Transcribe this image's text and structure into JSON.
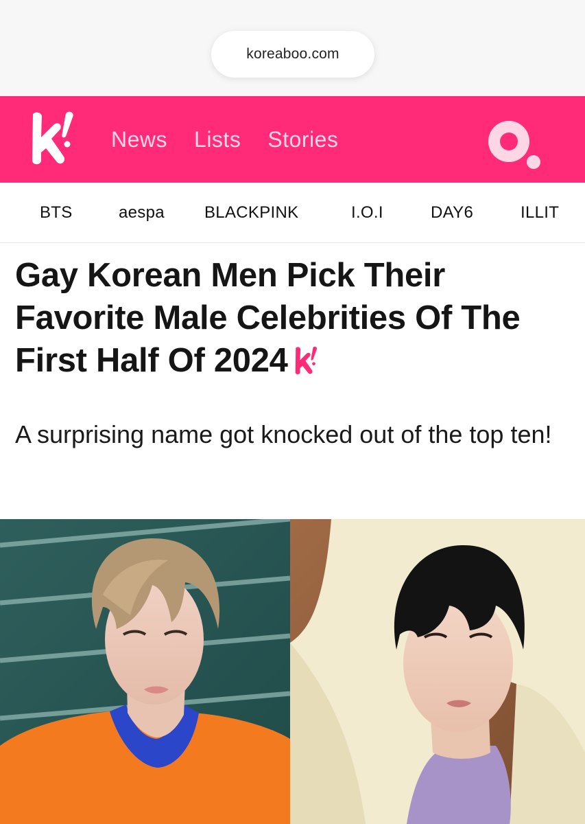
{
  "browser": {
    "url": "koreaboo.com"
  },
  "header": {
    "brand_color": "#ff2b78",
    "nav": [
      {
        "label": "News"
      },
      {
        "label": "Lists"
      },
      {
        "label": "Stories"
      }
    ],
    "search_icon": "search-icon"
  },
  "topics": [
    {
      "label": "BTS"
    },
    {
      "label": "aespa"
    },
    {
      "label": "BLACKPINK"
    },
    {
      "label": "I.O.I"
    },
    {
      "label": "DAY6"
    },
    {
      "label": "ILLIT"
    }
  ],
  "article": {
    "title": "Gay Korean Men Pick Their Favorite Male Celebrities Of The First Half Of 2024",
    "subtitle": "A surprising name got knocked out of the top ten!",
    "hero_images": [
      {
        "description_icon": "photo-man-blond-hair-orange-shirt"
      },
      {
        "description_icon": "photo-man-black-hair-cream-coat"
      }
    ]
  }
}
